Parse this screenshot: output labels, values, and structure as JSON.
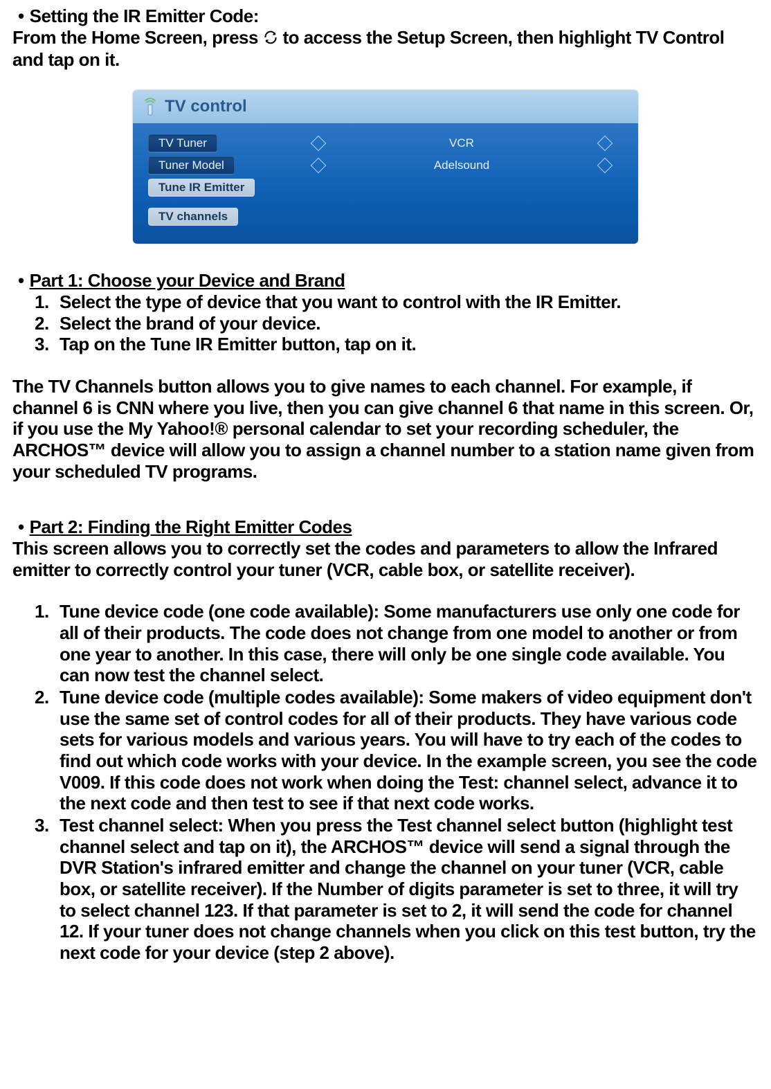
{
  "heading1_bullet": "•",
  "heading1": "Setting the IR Emitter Code:",
  "intro_before": "From the Home Screen, press",
  "intro_after": "to access the Setup Screen, then highlight TV Control and tap on it.",
  "icon_name": "refresh-icon",
  "tv_control": {
    "title": "TV control",
    "row_tuner_label": "TV Tuner",
    "row_tuner_value": "VCR",
    "row_model_label": "Tuner Model",
    "row_model_value": "Adelsound",
    "row_emitter_label": "Tune IR Emitter",
    "row_channels_label": "TV channels"
  },
  "part1_bullet": "•",
  "part1_heading": "Part 1: Choose your Device and Brand",
  "part1_items": {
    "n1": "1.",
    "t1": "Select the type of device that you want to control with the IR Emitter.",
    "n2": "2.",
    "t2": "Select the brand of your device.",
    "n3": "3.",
    "t3": "Tap on the Tune IR Emitter button, tap on it."
  },
  "channels_para": "The TV Channels button allows you to give names to each channel. For example, if channel 6 is CNN where you live, then you can give channel 6 that name in this screen. Or, if you use the My Yahoo!® personal calendar to set your recording scheduler, the ARCHOS™ device will allow you to assign a channel number to a station name given from your scheduled TV programs.",
  "part2_bullet": "•",
  "part2_heading": "Part 2: Finding the Right Emitter Codes",
  "part2_intro": "This screen allows you to correctly set the codes and parameters to allow the Infrared emitter to correctly control your tuner (VCR, cable box, or satellite receiver).",
  "part2_items": {
    "n1": "1.",
    "t1": "Tune device code (one code available): Some manufacturers use only one code for all of their products. The code does not change from one model to another or from one year to another. In this case, there will only be one single code available. You can now test the channel select.",
    "n2": "2.",
    "t2": "Tune device code (multiple codes available): Some makers of video equipment don't use the same set of control codes for all of their products. They have various code sets for various models and various years. You will have to try each of the codes to find out which code works with your device. In the example screen, you see the code V009. If this code does not work when doing the Test: channel select, advance it to the next code and then test to see if that next code works.",
    "n3": "3.",
    "t3": "Test channel select: When you press the Test channel select button (highlight test channel select and tap on it), the ARCHOS™ device will send a signal through the DVR Station's infrared emitter and change the channel on your tuner (VCR, cable box, or satellite receiver). If the Number of digits parameter is set to three, it will try to select channel 123. If that parameter is set to 2, it will send the code for channel 12. If your tuner does not change channels when you click on this test button, try the next code for your device (step 2 above)."
  }
}
